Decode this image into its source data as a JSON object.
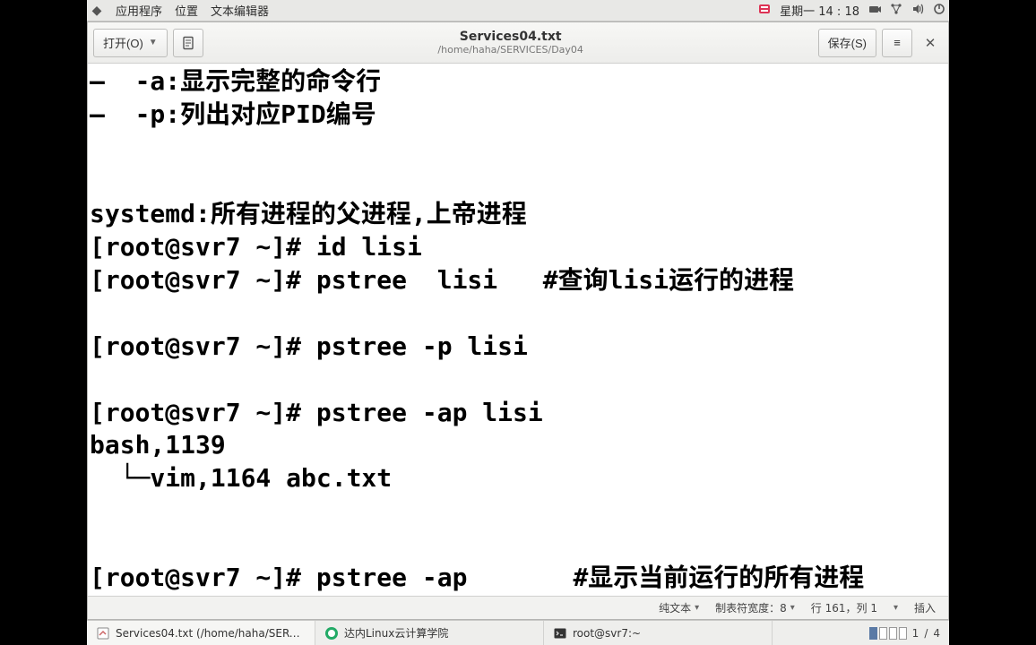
{
  "panel": {
    "apps_label": "应用程序",
    "places_label": "位置",
    "current_app": "文本编辑器",
    "clock": "星期一  14 : 18",
    "icons": {
      "gnome": "gnome-foot-icon",
      "input_method": "input-method-icon",
      "camera": "camera-icon",
      "network": "network-icon",
      "volume": "volume-icon",
      "power": "power-icon"
    }
  },
  "editor": {
    "open_label": "打开(O)",
    "save_label": "保存(S)",
    "title": "Services04.txt",
    "path": "/home/haha/SERVICES/Day04",
    "content_lines": [
      "—  -a:显示完整的命令行",
      "—  -p:列出对应PID编号",
      "",
      "",
      "systemd:所有进程的父进程,上帝进程",
      "[root@svr7 ~]# id lisi",
      "[root@svr7 ~]# pstree  lisi   #查询lisi运行的进程",
      "",
      "[root@svr7 ~]# pstree -p lisi",
      "",
      "[root@svr7 ~]# pstree -ap lisi",
      "bash,1139",
      "  └─vim,1164 abc.txt",
      "",
      "",
      "[root@svr7 ~]# pstree -ap       #显示当前运行的所有进程"
    ]
  },
  "statusbar": {
    "syntax": "纯文本",
    "tab_width_label": "制表符宽度：8",
    "position": "行 161，列 1",
    "mode": "插入"
  },
  "taskbar": {
    "items": [
      {
        "label": "Services04.txt (/home/haha/SERVIC…",
        "icon": "text-editor-icon",
        "active": true
      },
      {
        "label": "达内Linux云计算学院",
        "icon": "firefox-icon",
        "active": false
      },
      {
        "label": "root@svr7:~",
        "icon": "terminal-icon",
        "active": false
      }
    ],
    "pager": {
      "current": "1",
      "total": "4"
    }
  }
}
